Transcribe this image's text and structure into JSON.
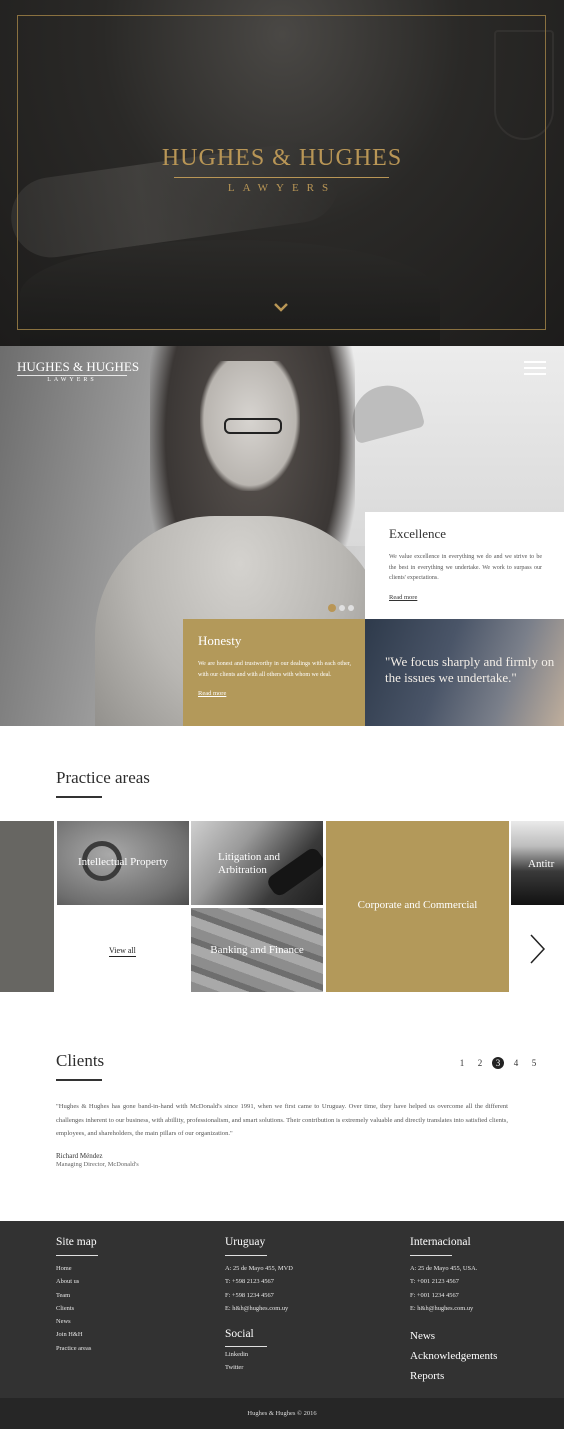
{
  "hero": {
    "title": "HUGHES & HUGHES",
    "subtitle": "LAWYERS"
  },
  "nav": {
    "logo_title": "HUGHES & HUGHES",
    "logo_sub": "LAWYERS"
  },
  "slider": {
    "active_index": 0,
    "count": 3
  },
  "excellence": {
    "title": "Excellence",
    "text": "We value excellence in everything we do and we strive to be the best in everything we undertake. We work to surpass our clients' expectations.",
    "link": "Read more"
  },
  "honesty": {
    "title": "Honesty",
    "text": "We are honest and trustworthy in our dealings with each other, with our clients and with all others with whom we deal.",
    "link": "Read more"
  },
  "quote": {
    "text": "\"We focus sharply and firmly on the issues we undertake.\""
  },
  "practice": {
    "title": "Practice areas",
    "tiles": {
      "ip": "Intellectual Property",
      "litigation": "Litigation and Arbitration",
      "banking": "Banking and Finance",
      "corporate": "Corporate and Commercial",
      "antitrust": "Antitr"
    },
    "view_all": "View all"
  },
  "clients": {
    "title": "Clients",
    "pages": [
      "1",
      "2",
      "3",
      "4",
      "5"
    ],
    "active_page": "3",
    "testimonial": "\"Hughes & Hughes has gone band-in-hand with McDonald's since 1991, when we first came to Uruguay. Over time, they have helped us overcome all the different challenges inherent to our business, with abillity, professionalism, and smart solutions. Their contribution is extremely valuable and directly translates into satisfied clients, employees, and shareholders, the main pillars of our organization.\"",
    "author": "Richard Méndez",
    "author_role": "Managing Director, McDonald's"
  },
  "footer": {
    "sitemap_title": "Site map",
    "sitemap": [
      "Home",
      "About us",
      "Team",
      "Clients",
      "News",
      "Join H&H",
      "Practice areas"
    ],
    "uruguay_title": "Uruguay",
    "uruguay": [
      "A: 25 de Mayo 455, MVD",
      "T: +598 2123 4567",
      "F: +598 1234 4567",
      "E: h&h@hughes.com.uy"
    ],
    "social_title": "Social",
    "social": [
      "Linkedin",
      "Twitter"
    ],
    "intl_title": "Internacional",
    "intl": [
      "A: 25 de Mayo 455, USA.",
      "T: +001 2123 4567",
      "F: +001 1234 4567",
      "E: h&h@hughes.com.uy"
    ],
    "extra_links": [
      "News",
      "Acknowledgements",
      "Reports"
    ],
    "copyright": "Hughes & Hughes © 2016"
  },
  "colors": {
    "gold": "#b3995a",
    "dark": "#323232"
  }
}
